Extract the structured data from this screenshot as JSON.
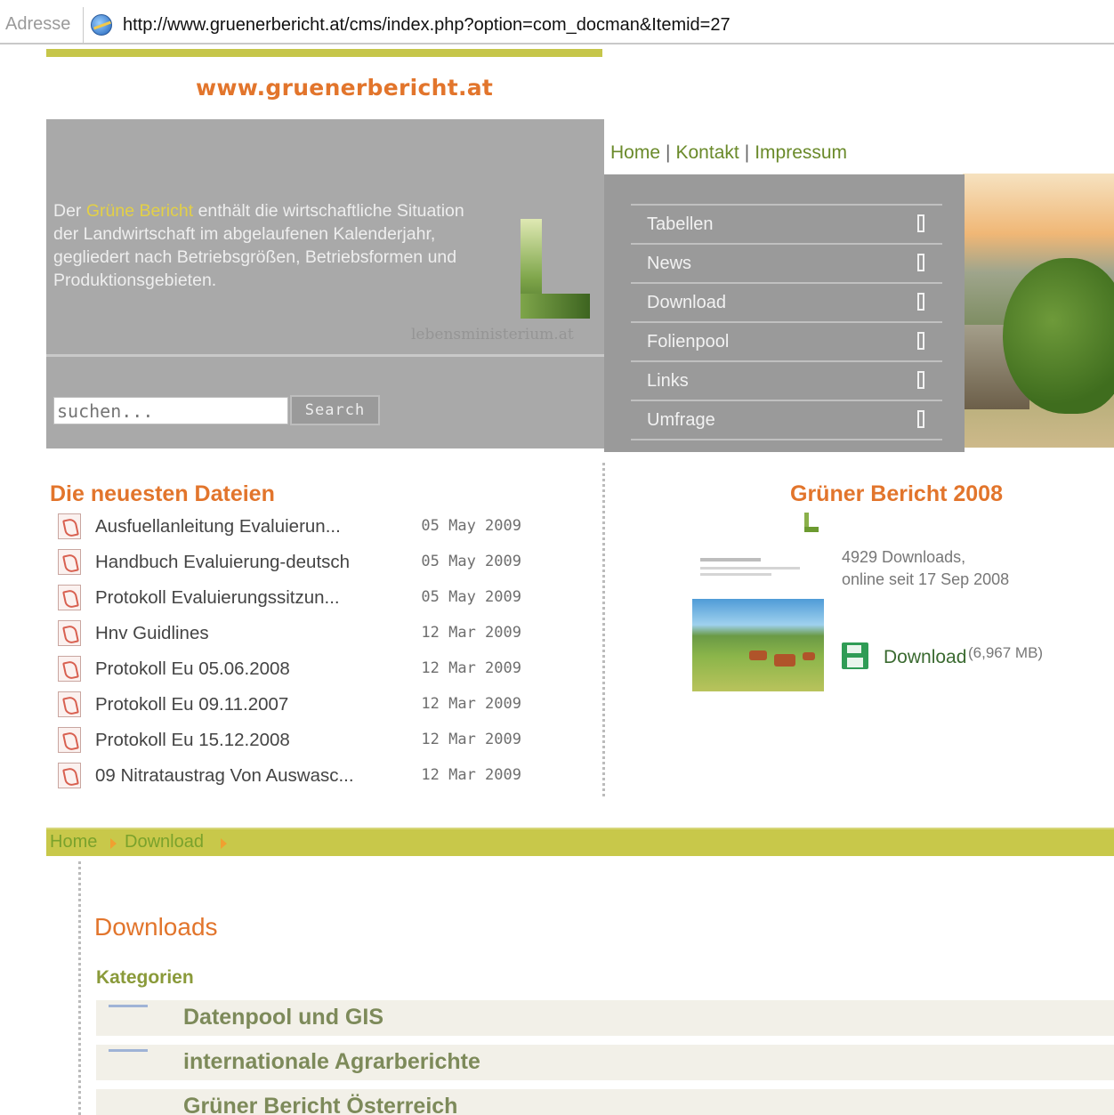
{
  "browser": {
    "address_label": "Adresse",
    "url": "http://www.gruenerbericht.at/cms/index.php?option=com_docman&Itemid=27"
  },
  "header": {
    "site_title": "www.gruenerbericht.at",
    "intro_pre": "Der ",
    "intro_highlight": "Grüne Bericht",
    "intro_post": " enthält die wirtschaftliche Situation der Landwirtschaft im abgelaufenen Kalenderjahr, gegliedert nach Betriebsgrößen, Betriebsformen und Produktionsgebieten.",
    "partner_text": "lebensministerium.at",
    "search_placeholder": "suchen...",
    "search_button": "Search"
  },
  "topnav": {
    "items": [
      "Home",
      "Kontakt",
      "Impressum"
    ],
    "separator": "|"
  },
  "menu": {
    "items": [
      "Tabellen",
      "News",
      "Download",
      "Folienpool",
      "Links",
      "Umfrage"
    ]
  },
  "latest": {
    "title": "Die neuesten Dateien",
    "files": [
      {
        "name": "Ausfuellanleitung Evaluierun...",
        "date": "05 May 2009"
      },
      {
        "name": "Handbuch Evaluierung-deutsch",
        "date": "05 May 2009"
      },
      {
        "name": "Protokoll Evaluierungssitzun...",
        "date": "05 May 2009"
      },
      {
        "name": "Hnv Guidlines",
        "date": "12 Mar 2009"
      },
      {
        "name": "Protokoll Eu 05.06.2008",
        "date": "12 Mar 2009"
      },
      {
        "name": "Protokoll Eu 09.11.2007",
        "date": "12 Mar 2009"
      },
      {
        "name": "Protokoll Eu 15.12.2008",
        "date": "12 Mar 2009"
      },
      {
        "name": "09 Nitrataustrag Von Auswasc...",
        "date": "12 Mar 2009"
      }
    ]
  },
  "featured": {
    "title": "Grüner Bericht 2008",
    "downloads": "4929 Downloads,",
    "online_since": "online seit 17 Sep 2008",
    "download_label": "Download",
    "size": "(6,967 MB)"
  },
  "breadcrumb": {
    "items": [
      "Home",
      "Download"
    ]
  },
  "downloads": {
    "title": "Downloads",
    "categories_label": "Kategorien",
    "categories": [
      "Datenpool und GIS",
      "internationale Agrarberichte",
      "Grüner Bericht Österreich"
    ]
  },
  "colors": {
    "accent_orange": "#e2752c",
    "stripe_green": "#c6c64a",
    "panel_gray": "#a9a9a9",
    "menu_gray": "#9a9a9a"
  }
}
